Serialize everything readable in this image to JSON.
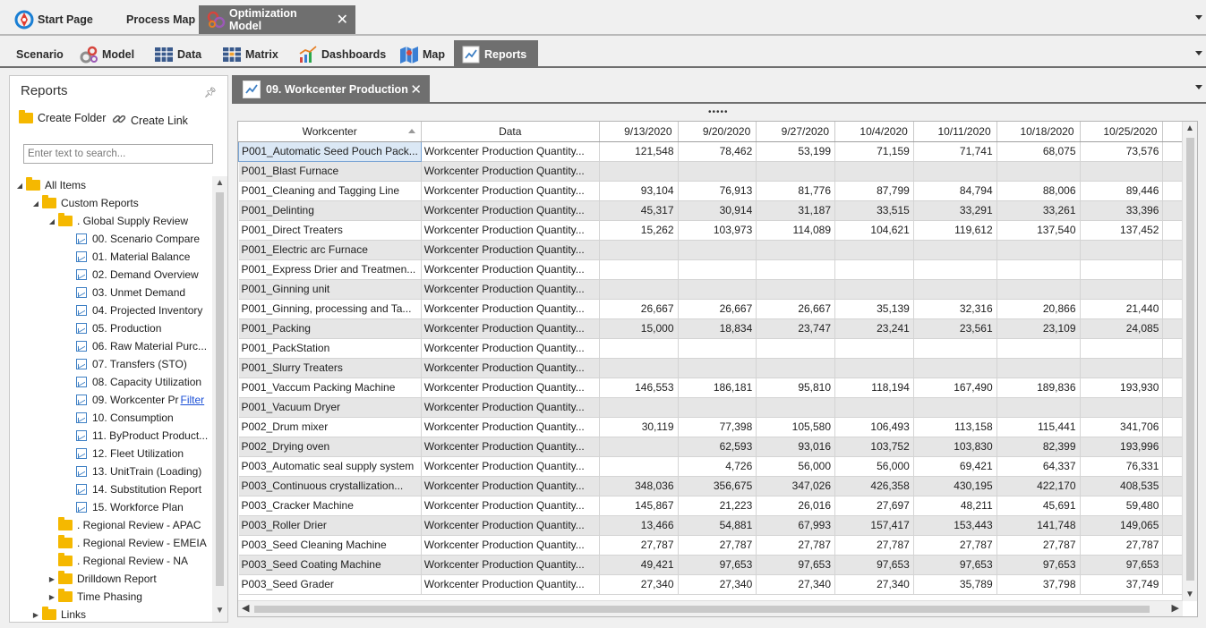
{
  "doc_tabs": [
    {
      "label": "Start Page",
      "icon": "start-page-icon"
    },
    {
      "label": "Process Map",
      "icon": ""
    },
    {
      "label": "Optimization Model",
      "icon": "optimization-model-icon",
      "active": true
    }
  ],
  "ribbon_tabs": [
    {
      "label": "Scenario",
      "icon": ""
    },
    {
      "label": "Model",
      "icon": "model-gears-icon"
    },
    {
      "label": "Data",
      "icon": "data-table-icon"
    },
    {
      "label": "Matrix",
      "icon": "matrix-icon"
    },
    {
      "label": "Dashboards",
      "icon": "dashboards-icon"
    },
    {
      "label": "Map",
      "icon": "map-icon"
    },
    {
      "label": "Reports",
      "icon": "reports-icon",
      "active": true
    }
  ],
  "left_panel": {
    "title": "Reports",
    "create_folder": "Create Folder",
    "create_link": "Create Link",
    "search_placeholder": "Enter text to search...",
    "tree": [
      {
        "label": "All Items",
        "type": "folder",
        "level": 0,
        "expanded": true
      },
      {
        "label": "Custom Reports",
        "type": "folder",
        "level": 1,
        "expanded": true
      },
      {
        "label": ". Global Supply Review",
        "type": "folder",
        "level": 2,
        "expanded": true
      },
      {
        "label": "00. Scenario Compare",
        "type": "report",
        "level": 3
      },
      {
        "label": "01. Material Balance",
        "type": "report",
        "level": 3
      },
      {
        "label": "02. Demand Overview",
        "type": "report",
        "level": 3
      },
      {
        "label": "03. Unmet Demand",
        "type": "report",
        "level": 3
      },
      {
        "label": "04. Projected Inventory",
        "type": "report",
        "level": 3
      },
      {
        "label": "05. Production",
        "type": "report",
        "level": 3
      },
      {
        "label": "06. Raw Material Purc...",
        "type": "report",
        "level": 3
      },
      {
        "label": "07. Transfers (STO)",
        "type": "report",
        "level": 3
      },
      {
        "label": "08. Capacity Utilization",
        "type": "report",
        "level": 3
      },
      {
        "label": "09. Workcenter Pr",
        "type": "report",
        "level": 3,
        "link": "Filter"
      },
      {
        "label": "10. Consumption",
        "type": "report",
        "level": 3
      },
      {
        "label": "11. ByProduct Product...",
        "type": "report",
        "level": 3
      },
      {
        "label": "12. Fleet Utilization",
        "type": "report",
        "level": 3
      },
      {
        "label": "13. UnitTrain (Loading)",
        "type": "report",
        "level": 3
      },
      {
        "label": "14. Substitution Report",
        "type": "report",
        "level": 3
      },
      {
        "label": "15. Workforce Plan",
        "type": "report",
        "level": 3
      },
      {
        "label": ". Regional Review - APAC",
        "type": "folder",
        "level": 2
      },
      {
        "label": ". Regional Review - EMEIA",
        "type": "folder",
        "level": 2
      },
      {
        "label": ". Regional Review - NA",
        "type": "folder",
        "level": 2
      },
      {
        "label": "Drilldown Report",
        "type": "folder",
        "level": 2,
        "collapsed": true
      },
      {
        "label": "Time Phasing",
        "type": "folder",
        "level": 2,
        "collapsed": true
      },
      {
        "label": "Links",
        "type": "folder",
        "level": 1,
        "collapsed": true
      }
    ]
  },
  "report_tab": {
    "label": "09. Workcenter Production"
  },
  "grid": {
    "columns": [
      "Workcenter",
      "Data",
      "9/13/2020",
      "9/20/2020",
      "9/27/2020",
      "10/4/2020",
      "10/11/2020",
      "10/18/2020",
      "10/25/2020"
    ],
    "rows": [
      [
        "P001_Automatic Seed Pouch Pack...",
        "Workcenter  Production  Quantity...",
        "121,548",
        "78,462",
        "53,199",
        "71,159",
        "71,741",
        "68,075",
        "73,576"
      ],
      [
        "P001_Blast Furnace",
        "Workcenter  Production  Quantity...",
        "",
        "",
        "",
        "",
        "",
        "",
        ""
      ],
      [
        "P001_Cleaning and Tagging Line",
        "Workcenter  Production  Quantity...",
        "93,104",
        "76,913",
        "81,776",
        "87,799",
        "84,794",
        "88,006",
        "89,446"
      ],
      [
        "P001_Delinting",
        "Workcenter  Production  Quantity...",
        "45,317",
        "30,914",
        "31,187",
        "33,515",
        "33,291",
        "33,261",
        "33,396"
      ],
      [
        "P001_Direct Treaters",
        "Workcenter  Production  Quantity...",
        "15,262",
        "103,973",
        "114,089",
        "104,621",
        "119,612",
        "137,540",
        "137,452"
      ],
      [
        "P001_Electric arc Furnace",
        "Workcenter  Production  Quantity...",
        "",
        "",
        "",
        "",
        "",
        "",
        ""
      ],
      [
        "P001_Express  Drier  and  Treatmen...",
        "Workcenter  Production  Quantity...",
        "",
        "",
        "",
        "",
        "",
        "",
        ""
      ],
      [
        "P001_Ginning unit",
        "Workcenter  Production  Quantity...",
        "",
        "",
        "",
        "",
        "",
        "",
        ""
      ],
      [
        "P001_Ginning,  processing  and  Ta...",
        "Workcenter  Production  Quantity...",
        "26,667",
        "26,667",
        "26,667",
        "35,139",
        "32,316",
        "20,866",
        "21,440"
      ],
      [
        "P001_Packing",
        "Workcenter  Production  Quantity...",
        "15,000",
        "18,834",
        "23,747",
        "23,241",
        "23,561",
        "23,109",
        "24,085"
      ],
      [
        "P001_PackStation",
        "Workcenter  Production  Quantity...",
        "",
        "",
        "",
        "",
        "",
        "",
        ""
      ],
      [
        "P001_Slurry Treaters",
        "Workcenter  Production  Quantity...",
        "",
        "",
        "",
        "",
        "",
        "",
        ""
      ],
      [
        "P001_Vaccum Packing Machine",
        "Workcenter  Production  Quantity...",
        "146,553",
        "186,181",
        "95,810",
        "118,194",
        "167,490",
        "189,836",
        "193,930"
      ],
      [
        "P001_Vacuum Dryer",
        "Workcenter  Production  Quantity...",
        "",
        "",
        "",
        "",
        "",
        "",
        ""
      ],
      [
        "P002_Drum mixer",
        "Workcenter  Production  Quantity...",
        "30,119",
        "77,398",
        "105,580",
        "106,493",
        "113,158",
        "115,441",
        "341,706"
      ],
      [
        "P002_Drying oven",
        "Workcenter  Production  Quantity...",
        "",
        "62,593",
        "93,016",
        "103,752",
        "103,830",
        "82,399",
        "193,996"
      ],
      [
        "P003_Automatic seal supply system",
        "Workcenter  Production  Quantity...",
        "",
        "4,726",
        "56,000",
        "56,000",
        "69,421",
        "64,337",
        "76,331"
      ],
      [
        "P003_Continuous  crystallization...",
        "Workcenter  Production  Quantity...",
        "348,036",
        "356,675",
        "347,026",
        "426,358",
        "430,195",
        "422,170",
        "408,535"
      ],
      [
        "P003_Cracker Machine",
        "Workcenter  Production  Quantity...",
        "145,867",
        "21,223",
        "26,016",
        "27,697",
        "48,211",
        "45,691",
        "59,480"
      ],
      [
        "P003_Roller Drier",
        "Workcenter  Production  Quantity...",
        "13,466",
        "54,881",
        "67,993",
        "157,417",
        "153,443",
        "141,748",
        "149,065"
      ],
      [
        "P003_Seed Cleaning Machine",
        "Workcenter  Production  Quantity...",
        "27,787",
        "27,787",
        "27,787",
        "27,787",
        "27,787",
        "27,787",
        "27,787"
      ],
      [
        "P003_Seed Coating Machine",
        "Workcenter  Production  Quantity...",
        "49,421",
        "97,653",
        "97,653",
        "97,653",
        "97,653",
        "97,653",
        "97,653"
      ],
      [
        "P003_Seed Grader",
        "Workcenter  Production  Quantity...",
        "27,340",
        "27,340",
        "27,340",
        "27,340",
        "35,789",
        "37,798",
        "37,749"
      ]
    ]
  },
  "colors": {
    "active_tab": "#6f6f6f",
    "alt_row": "#e6e6e6",
    "folder": "#f5b800",
    "report_icon": "#3d7fc4",
    "link": "#1a4fd6"
  }
}
